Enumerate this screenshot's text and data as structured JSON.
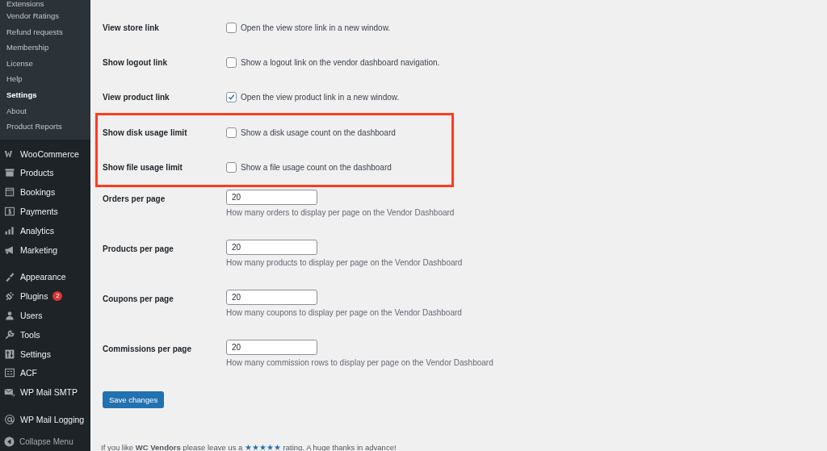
{
  "sidebar": {
    "submenu": [
      {
        "label": "Extensions",
        "selected": false
      },
      {
        "label": "Vendor Ratings",
        "selected": false
      },
      {
        "label": "Refund requests",
        "selected": false
      },
      {
        "label": "Membership",
        "selected": false
      },
      {
        "label": "License",
        "selected": false
      },
      {
        "label": "Help",
        "selected": false
      },
      {
        "label": "Settings",
        "selected": true
      },
      {
        "label": "About",
        "selected": false
      },
      {
        "label": "Product Reports",
        "selected": false
      }
    ],
    "groups": [
      {
        "items": [
          {
            "label": "WooCommerce"
          },
          {
            "label": "Products"
          },
          {
            "label": "Bookings"
          },
          {
            "label": "Payments"
          },
          {
            "label": "Analytics"
          },
          {
            "label": "Marketing"
          }
        ]
      },
      {
        "items": [
          {
            "label": "Appearance"
          },
          {
            "label": "Plugins",
            "badge": "2"
          },
          {
            "label": "Users"
          },
          {
            "label": "Tools"
          },
          {
            "label": "Settings"
          },
          {
            "label": "ACF"
          },
          {
            "label": "WP Mail SMTP"
          }
        ]
      },
      {
        "items": [
          {
            "label": "WP Mail Logging"
          }
        ]
      }
    ],
    "collapse": "Collapse Menu"
  },
  "checkbox_rows": [
    {
      "label": "View store link",
      "text": "Open the view store link in a new window.",
      "checked": false,
      "highlighted": false
    },
    {
      "label": "Show logout link",
      "text": "Show a logout link on the vendor dashboard navigation.",
      "checked": false,
      "highlighted": false
    },
    {
      "label": "View product link",
      "text": "Open the view product link in a new window.",
      "checked": true,
      "highlighted": false
    },
    {
      "label": "Show disk usage limit",
      "text": "Show a disk usage count on the dashboard",
      "checked": false,
      "highlighted": true
    },
    {
      "label": "Show file usage limit",
      "text": "Show a file usage count on the dashboard",
      "checked": false,
      "highlighted": true
    }
  ],
  "number_rows": [
    {
      "label": "Orders per page",
      "value": "20",
      "help": "How many orders to display per page on the Vendor Dashboard"
    },
    {
      "label": "Products per page",
      "value": "20",
      "help": "How many products to display per page on the Vendor Dashboard"
    },
    {
      "label": "Coupons per page",
      "value": "20",
      "help": "How many coupons to display per page on the Vendor Dashboard"
    },
    {
      "label": "Commissions per page",
      "value": "20",
      "help": "How many commission rows to display per page on the Vendor Dashboard"
    }
  ],
  "save_button": "Save changes",
  "footer": {
    "before": "If you like **WC Vendors** please leave us a",
    "link": "★★★★★",
    "after": "rating. A huge thanks in advance!"
  }
}
